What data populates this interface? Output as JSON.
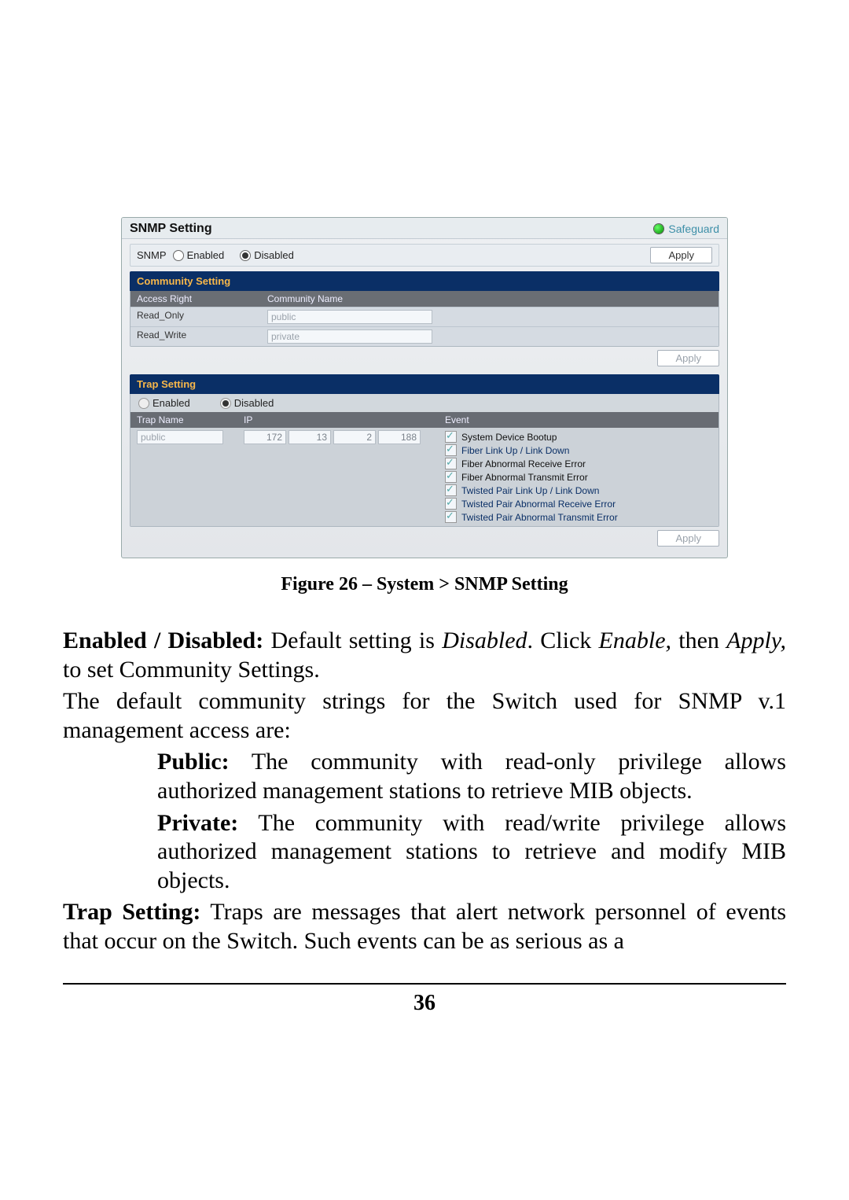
{
  "screenshot": {
    "title": "SNMP Setting",
    "safeguard": "Safeguard",
    "snmp_label": "SNMP",
    "enabled_label": "Enabled",
    "disabled_label": "Disabled",
    "apply_label": "Apply",
    "community": {
      "heading": "Community Setting",
      "cols": {
        "right": "Access Right",
        "name": "Community Name"
      },
      "rows": [
        {
          "right": "Read_Only",
          "name": "public"
        },
        {
          "right": "Read_Write",
          "name": "private"
        }
      ]
    },
    "trap": {
      "heading": "Trap Setting",
      "enabled_label": "Enabled",
      "disabled_label": "Disabled",
      "cols": {
        "name": "Trap Name",
        "ip": "IP",
        "event": "Event"
      },
      "row": {
        "name": "public",
        "ip": [
          "172",
          "13",
          "2",
          "188"
        ],
        "events": [
          "System Device Bootup",
          "Fiber Link Up / Link Down",
          "Fiber Abnormal Receive Error",
          "Fiber Abnormal Transmit Error",
          "Twisted Pair Link Up / Link Down",
          "Twisted Pair Abnormal Receive Error",
          "Twisted Pair Abnormal Transmit Error"
        ]
      }
    }
  },
  "caption": "Figure 26 – System > SNMP Setting",
  "text": {
    "p1_b": "Enabled / Disabled:",
    "p1_a": " Default setting is ",
    "p1_i1": "Disabled",
    "p1_b2": ". Click ",
    "p1_i2": "Enable,",
    "p1_c": " then ",
    "p1_i3": "Apply,",
    "p1_d": " to set Community Settings.",
    "p2": "The default community strings for the Switch used for SNMP v.1 management access are:",
    "pub_b": "Public:",
    "pub_t": " The community with read-only privilege allows authorized management stations to retrieve MIB objects.",
    "priv_b": "Private:",
    "priv_t": " The community with read/write privilege allows authorized management stations to retrieve and modify MIB objects.",
    "trap_b": "Trap Setting:",
    "trap_t": " Traps are messages that alert network personnel of events that occur on the Switch. Such events can be as serious as a"
  },
  "page_number": "36"
}
